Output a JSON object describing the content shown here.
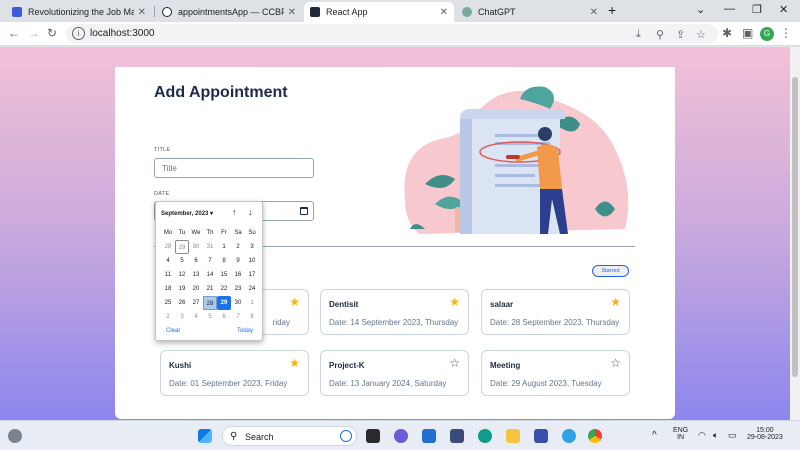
{
  "browser": {
    "tabs": [
      {
        "label": "Revolutionizing the Job Market |",
        "fav_color": "#3b5bdb"
      },
      {
        "label": "appointmentsApp — CCBP IDE",
        "fav_color": "#202124"
      },
      {
        "label": "React App",
        "fav_color": "#1f2937"
      },
      {
        "label": "ChatGPT",
        "fav_color": "#74aa9c"
      }
    ],
    "url": "localhost:3000",
    "profile_initial": "G"
  },
  "form": {
    "heading": "Add Appointment",
    "title_label": "TITLE",
    "title_placeholder": "Title",
    "date_label": "DATE",
    "date_value": "29-09-2023"
  },
  "calendar": {
    "month_label": "September, 2023",
    "weekdays": [
      "Mo",
      "Tu",
      "We",
      "Th",
      "Fr",
      "Sa",
      "Su"
    ],
    "days": [
      "28",
      "29",
      "30",
      "31",
      "1",
      "2",
      "3",
      "4",
      "5",
      "6",
      "7",
      "8",
      "9",
      "10",
      "11",
      "12",
      "13",
      "14",
      "15",
      "16",
      "17",
      "18",
      "19",
      "20",
      "21",
      "22",
      "23",
      "24",
      "25",
      "26",
      "27",
      "28",
      "29",
      "30",
      "1",
      "2",
      "3",
      "4",
      "5",
      "6",
      "7",
      "8"
    ],
    "clear_label": "Clear",
    "today_label": "Today"
  },
  "starred_label": "Starred",
  "appointments": [
    {
      "name": "",
      "date": "riday",
      "starred": true
    },
    {
      "name": "Dentisit",
      "date": "Date: 14 September 2023, Thursday",
      "starred": true
    },
    {
      "name": "salaar",
      "date": "Date: 28 September 2023, Thursday",
      "starred": true
    },
    {
      "name": "Kushi",
      "date": "Date: 01 September 2023, Friday",
      "starred": true
    },
    {
      "name": "Project-K",
      "date": "Date: 13 January 2024, Saturday",
      "starred": false
    },
    {
      "name": "Meeting",
      "date": "Date: 29 August 2023, Tuesday",
      "starred": false
    }
  ],
  "taskbar": {
    "search_label": "Search",
    "lang_top": "ENG",
    "lang_bottom": "IN",
    "time": "15:00",
    "date": "29-08-2023"
  },
  "colors": {
    "accent": "#1a73e8",
    "star": "#f5b50a",
    "heading": "#1e2a4a"
  }
}
